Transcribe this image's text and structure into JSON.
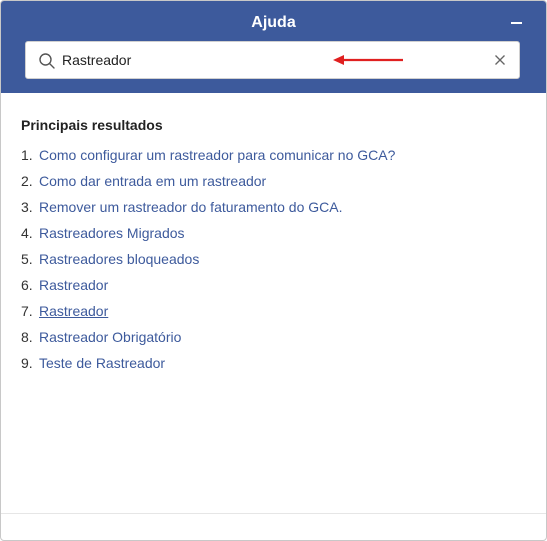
{
  "header": {
    "title": "Ajuda",
    "minimize_icon": "minimize-icon",
    "background_color": "#3d5a9c"
  },
  "search": {
    "value": "Rastreador",
    "icons": [
      "search-icon",
      "close-icon"
    ],
    "annotation_arrow_color": "#e02020"
  },
  "results": {
    "heading": "Principais resultados",
    "link_color": "#3d5a9c",
    "items": [
      {
        "num": "1.",
        "label": "Como configurar um rastreador para comunicar no GCA?"
      },
      {
        "num": "2.",
        "label": "Como dar entrada em um rastreador"
      },
      {
        "num": "3.",
        "label": "Remover um rastreador do faturamento do GCA."
      },
      {
        "num": "4.",
        "label": "Rastreadores Migrados"
      },
      {
        "num": "5.",
        "label": "Rastreadores bloqueados"
      },
      {
        "num": "6.",
        "label": "Rastreador"
      },
      {
        "num": "7.",
        "label": "Rastreador"
      },
      {
        "num": "8.",
        "label": "Rastreador Obrigatório"
      },
      {
        "num": "9.",
        "label": "Teste de Rastreador"
      }
    ]
  }
}
